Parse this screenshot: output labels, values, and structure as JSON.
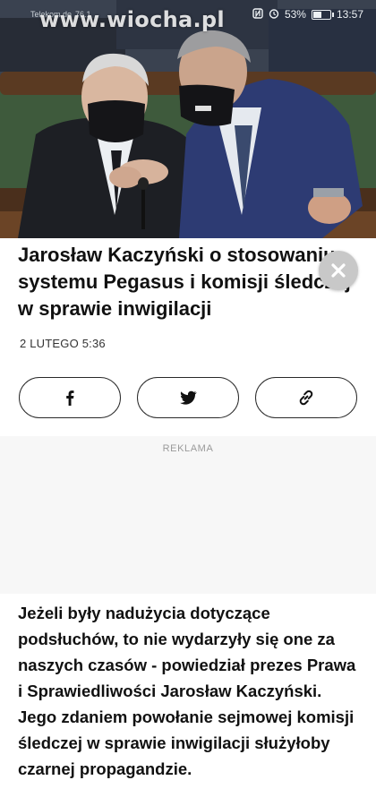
{
  "status_bar": {
    "carrier": "Telekom.de",
    "signal_value": "76.1",
    "battery": "53%",
    "battery_level": 0.53,
    "time": "13:57",
    "icons": [
      "nfc-icon",
      "alarm-icon",
      "battery-icon"
    ]
  },
  "watermark": "www.wiocha.pl",
  "article": {
    "title": "Jarosław Kaczyński o stosowaniu systemu Pegasus i komisji śledczej w sprawie inwigilacji",
    "date": "2 LUTEGO 5:36",
    "body": "Jeżeli były nadużycia dotyczące podsłuchów, to nie wydarzyły się one za naszych czasów - powiedział prezes Prawa i Sprawiedliwości Jarosław Kaczyński. Jego zdaniem powołanie sejmowej komisji śledczej w sprawie inwigilacji służyłoby czarnej propagandzie."
  },
  "share": {
    "facebook": "facebook-icon",
    "twitter": "twitter-icon",
    "link": "link-icon"
  },
  "ad": {
    "label": "REKLAMA"
  }
}
